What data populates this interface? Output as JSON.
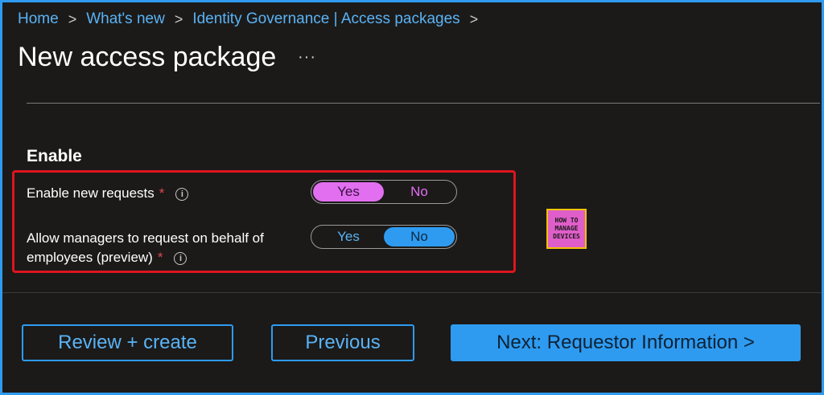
{
  "breadcrumb": {
    "items": [
      "Home",
      "What's new",
      "Identity Governance | Access packages"
    ],
    "separator": ">"
  },
  "page": {
    "title": "New access package",
    "more": "···"
  },
  "section": {
    "title": "Enable"
  },
  "fields": {
    "enable_new_requests": {
      "label": "Enable new requests",
      "required": "*",
      "info": "i",
      "options": [
        "Yes",
        "No"
      ],
      "selected": "Yes"
    },
    "allow_managers": {
      "label_line1": "Allow managers to request on behalf of",
      "label_line2": "employees (preview)",
      "required": "*",
      "info": "i",
      "options": [
        "Yes",
        "No"
      ],
      "selected": "No"
    }
  },
  "logo": {
    "line1": "HOW TO",
    "line2": "MANAGE",
    "line3": "DEVICES"
  },
  "footer": {
    "review_label": "Review + create",
    "previous_label": "Previous",
    "next_label": "Next: Requestor Information >"
  },
  "colors": {
    "accent": "#2f9bf0",
    "toggle_selected": "#e26ef0",
    "highlight_border": "#e0141e",
    "background": "#1b1a19"
  }
}
